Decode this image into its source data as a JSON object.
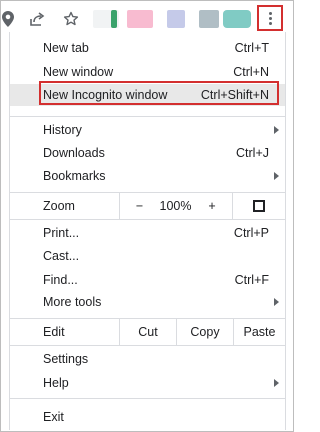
{
  "toolbar": {
    "icons": [
      "location-icon",
      "share-icon",
      "star-icon"
    ],
    "extension_colors": [
      "#3aa26b",
      "#f48fb1",
      "#9fa8da",
      "#78909c",
      "#26a69a"
    ]
  },
  "menu": {
    "items_group1": [
      {
        "label": "New tab",
        "shortcut": "Ctrl+T"
      },
      {
        "label": "New window",
        "shortcut": "Ctrl+N"
      },
      {
        "label": "New Incognito window",
        "shortcut": "Ctrl+Shift+N"
      }
    ],
    "items_group2": [
      {
        "label": "History"
      },
      {
        "label": "Downloads",
        "shortcut": "Ctrl+J"
      },
      {
        "label": "Bookmarks"
      }
    ],
    "zoom": {
      "label": "Zoom",
      "minus": "−",
      "value": "100%",
      "plus": "+"
    },
    "items_group3": [
      {
        "label": "Print...",
        "shortcut": "Ctrl+P"
      },
      {
        "label": "Cast..."
      },
      {
        "label": "Find...",
        "shortcut": "Ctrl+F"
      },
      {
        "label": "More tools"
      }
    ],
    "edit": {
      "label": "Edit",
      "cut": "Cut",
      "copy": "Copy",
      "paste": "Paste"
    },
    "items_group4": [
      {
        "label": "Settings"
      },
      {
        "label": "Help"
      }
    ],
    "items_group5": [
      {
        "label": "Exit"
      }
    ]
  },
  "colors": {
    "highlight_border": "#d32f2f",
    "highlight_bg": "#e8e8e8"
  }
}
